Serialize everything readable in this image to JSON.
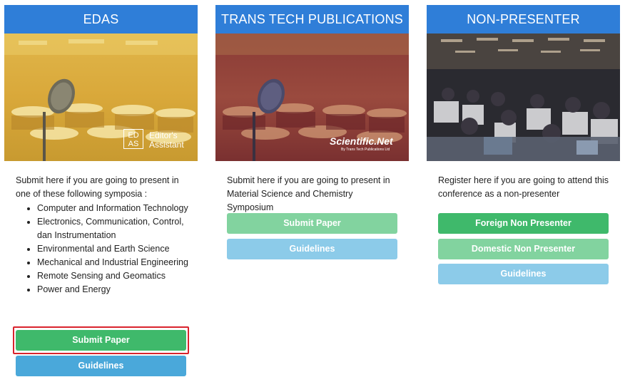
{
  "cards": [
    {
      "title": "EDAS",
      "badge_text": "ED\nAS",
      "logo_line1": "Editor's",
      "logo_line2": "Assistant",
      "description": "Submit here if you are going to present in one of these following symposia :",
      "symposia": [
        "Computer and Information Technology",
        "Electronics, Communication, Control, dan Instrumentation",
        "Environmental and Earth Science",
        "Mechanical and Industrial Engineering",
        "Remote Sensing and Geomatics",
        "Power and Energy"
      ],
      "buttons": [
        "Submit Paper",
        "Guidelines"
      ]
    },
    {
      "title": "TRANS TECH PUBLICATIONS",
      "logo_text": "Scientific.Net",
      "logo_sub": "By Trans Tech Publications Ltd",
      "description": "Submit here if you are going to present in Material Science and Chemistry Symposium",
      "buttons": [
        "Submit Paper",
        "Guidelines"
      ]
    },
    {
      "title": "NON-PRESENTER",
      "description": "Register here if you are going to attend this conference as a non-presenter",
      "buttons": [
        "Foreign Non Presenter",
        "Domestic Non Presenter",
        "Guidelines"
      ]
    }
  ],
  "colors": {
    "header_blue": "#2f7ed8",
    "green": "#3fb96b",
    "green_light": "#82d39f",
    "blue": "#4aa8da",
    "blue_light": "#8ccbe9",
    "highlight_red": "#d9232d"
  }
}
